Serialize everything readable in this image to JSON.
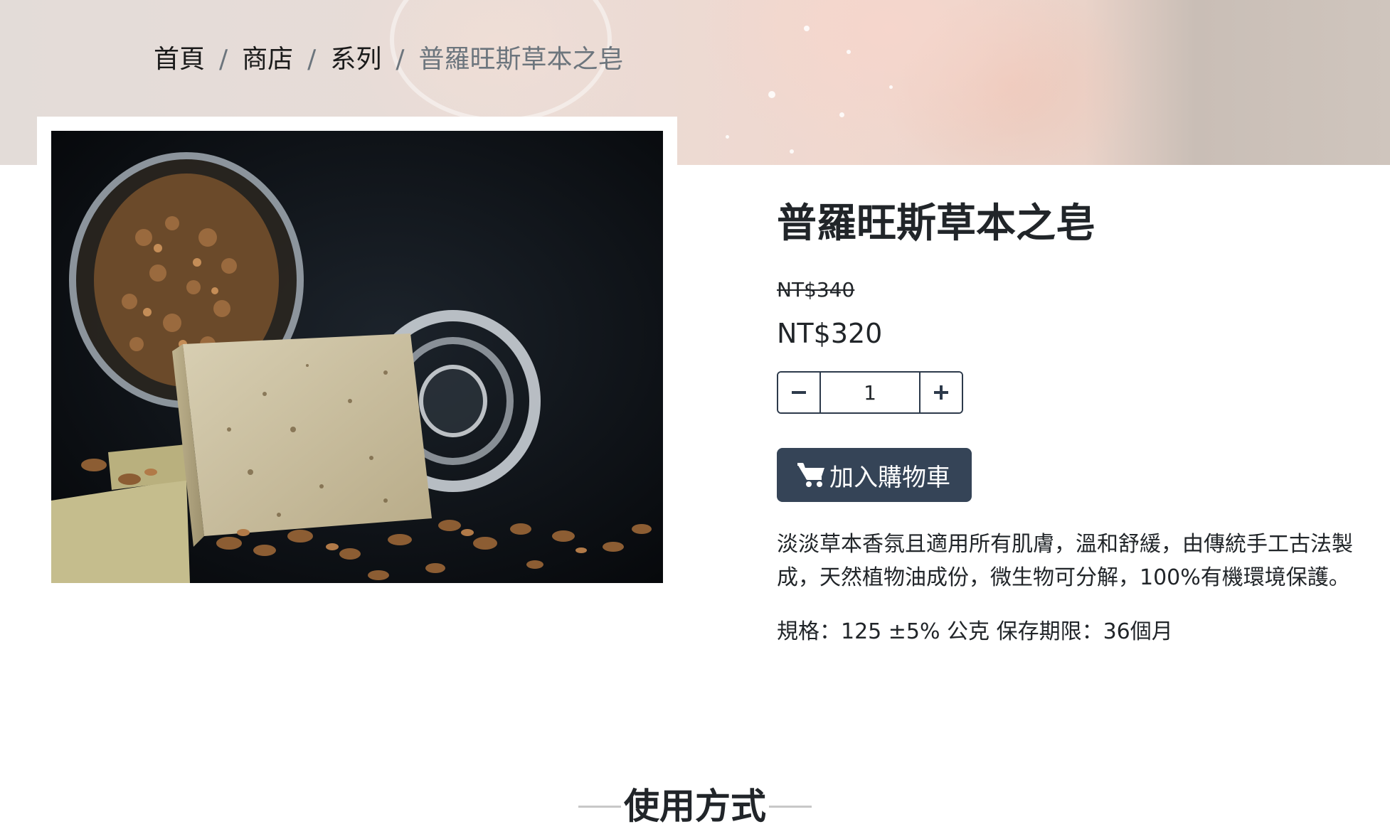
{
  "breadcrumb": {
    "items": [
      {
        "label": "首頁"
      },
      {
        "label": "商店"
      },
      {
        "label": "系列"
      }
    ],
    "separator": "/",
    "current": "普羅旺斯草本之皂"
  },
  "product": {
    "title": "普羅旺斯草本之皂",
    "original_price": "NT$340",
    "price": "NT$320",
    "quantity": "1",
    "add_to_cart_label": "加入購物車",
    "description": "淡淡草本香氛且適用所有肌膚，溫和舒緩，由傳統手工古法製成，天然植物油成份，微生物可分解，100%有機環境保護。",
    "spec": "規格：125 ±5% 公克 保存期限：36個月"
  },
  "section": {
    "usage_title": "使用方式"
  },
  "icons": {
    "minus": "minus-icon",
    "plus": "plus-icon",
    "cart": "cart-icon"
  },
  "colors": {
    "button_bg": "#354457",
    "stepper_border": "#2d3a4b",
    "breadcrumb_active": "#6c757d"
  }
}
